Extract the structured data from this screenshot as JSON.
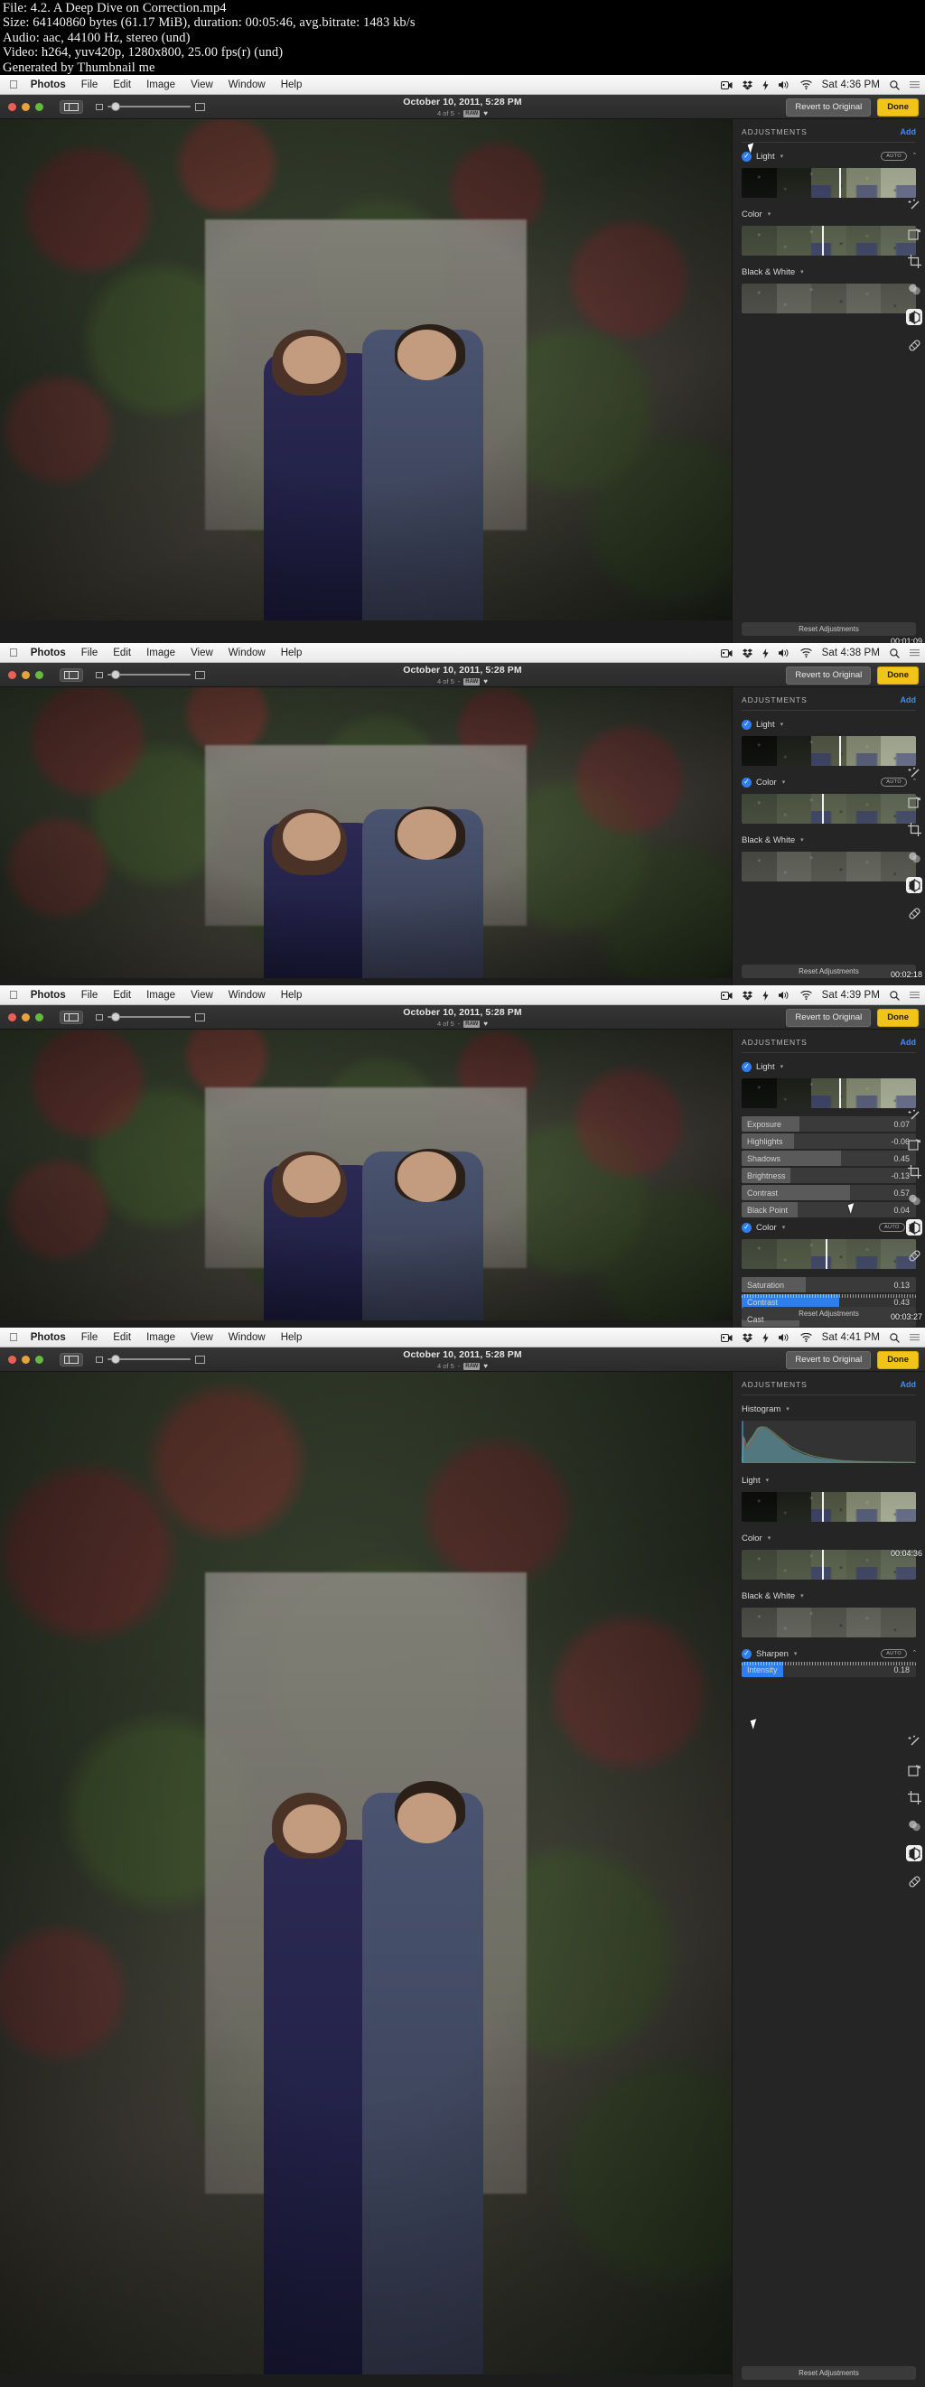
{
  "video_info": {
    "lines": [
      "File: 4.2. A Deep Dive on Correction.mp4",
      "Size: 64140860 bytes (61.17 MiB), duration: 00:05:46, avg.bitrate: 1483 kb/s",
      "Audio: aac, 44100 Hz, stereo (und)",
      "Video: h264, yuv420p, 1280x800, 25.00 fps(r) (und)",
      "Generated by Thumbnail me"
    ]
  },
  "menubar": {
    "apple_icon": "apple-icon",
    "items": [
      "Photos",
      "File",
      "Edit",
      "Image",
      "View",
      "Window",
      "Help"
    ],
    "status_icons": [
      "screen-recording-icon",
      "dropbox-icon",
      "battery-icon",
      "volume-icon",
      "wifi-icon"
    ],
    "search_icon": "search-icon",
    "list_icon": "notification-center-icon"
  },
  "toolbar": {
    "sidebar_toggle": "sidebar-toggle-icon",
    "zoom_small_icon": "thumbnail-small-icon",
    "zoom_large_icon": "thumbnail-large-icon",
    "title": "October 10, 2011, 5:28 PM",
    "subtitle_count": "4 of 5",
    "subtitle_sep": "-",
    "raw_badge": "RAW",
    "favorite_icon": "heart-icon",
    "revert_label": "Revert to Original",
    "done_label": "Done"
  },
  "adjustments": {
    "header": "ADJUSTMENTS",
    "add_label": "Add",
    "auto_label": "AUTO",
    "reset_label": "Reset Adjustments",
    "sections": {
      "histogram": "Histogram",
      "light": "Light",
      "color": "Color",
      "bw": "Black & White",
      "sharpen": "Sharpen"
    },
    "light_sliders": [
      {
        "label": "Exposure",
        "value": "0.07",
        "fill": 33
      },
      {
        "label": "Highlights",
        "value": "-0.06",
        "fill": 30
      },
      {
        "label": "Shadows",
        "value": "0.45",
        "fill": 57
      },
      {
        "label": "Brightness",
        "value": "-0.13",
        "fill": 28
      },
      {
        "label": "Contrast",
        "value": "0.57",
        "fill": 62
      },
      {
        "label": "Black Point",
        "value": "0.04",
        "fill": 32
      }
    ],
    "color_sliders": [
      {
        "label": "Saturation",
        "value": "0.13",
        "fill": 37
      },
      {
        "label": "Contrast",
        "value": "0.43",
        "fill": 56
      },
      {
        "label": "Cast",
        "value": "",
        "fill": 33
      }
    ],
    "sharpen_sliders": [
      {
        "label": "Intensity",
        "value": "0.18",
        "fill": 24
      }
    ]
  },
  "toolrail": {
    "icons": [
      "retouch-wand-icon",
      "rotate-icon",
      "crop-icon",
      "filters-icon",
      "adjust-dial-icon",
      "retouch-bandage-icon"
    ]
  },
  "panels": [
    {
      "clock": "Sat 4:36 PM",
      "timestamp": "00:01:09"
    },
    {
      "clock": "Sat 4:38 PM",
      "timestamp": "00:02:18"
    },
    {
      "clock": "Sat 4:39 PM",
      "timestamp": "00:03:27"
    },
    {
      "clock": "Sat 4:41 PM",
      "timestamp": "00:04:36"
    }
  ]
}
